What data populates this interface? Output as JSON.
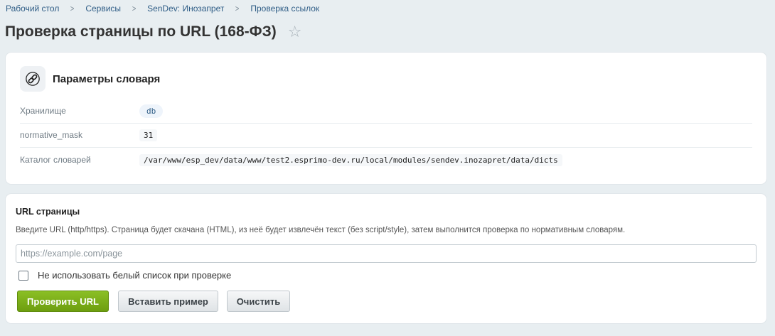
{
  "breadcrumb": {
    "items": [
      "Рабочий стол",
      "Сервисы",
      "SenDev: Инозапрет",
      "Проверка ссылок"
    ]
  },
  "page": {
    "title": "Проверка страницы по URL (168-ФЗ)"
  },
  "dictionary_params": {
    "title": "Параметры словаря",
    "rows": [
      {
        "label": "Хранилище",
        "value": "db"
      },
      {
        "label": "normative_mask",
        "value": "31"
      },
      {
        "label": "Каталог словарей",
        "value": "/var/www/esp_dev/data/www/test2.esprimo-dev.ru/local/modules/sendev.inozapret/data/dicts"
      }
    ]
  },
  "url_form": {
    "title": "URL страницы",
    "hint": "Введите URL (http/https). Страница будет скачана (HTML), из неё будет извлечён текст (без script/style), затем выполнится проверка по нормативным словарям.",
    "input_placeholder": "https://example.com/page",
    "input_value": "",
    "checkbox_label": "Не использовать белый список при проверке",
    "checkbox_checked": false,
    "buttons": {
      "check": "Проверить URL",
      "sample": "Вставить пример",
      "clear": "Очистить"
    }
  },
  "colors": {
    "primary_button": "#7aad18",
    "link": "#2f5d86",
    "background": "#e8eef1"
  }
}
